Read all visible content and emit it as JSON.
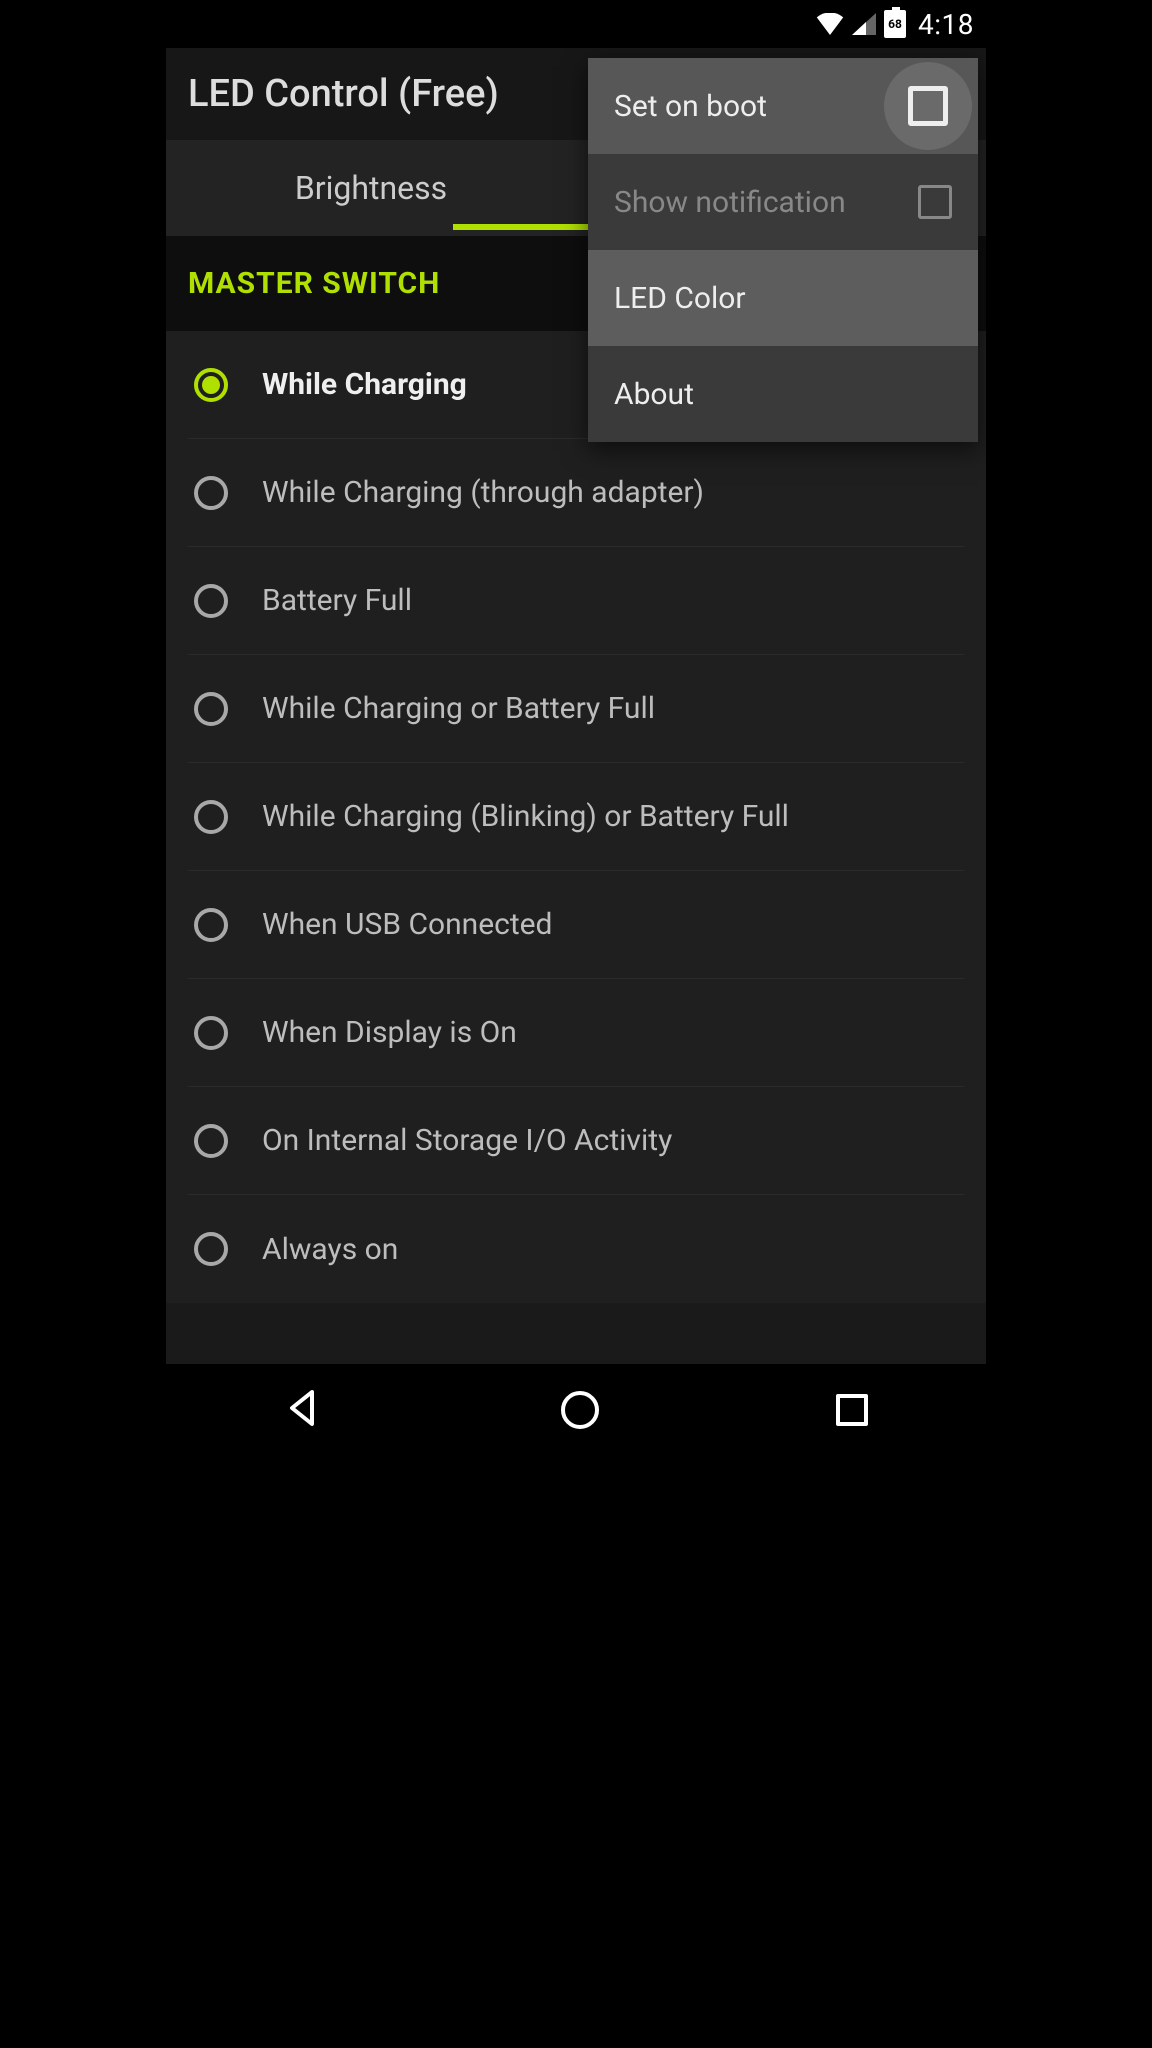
{
  "status": {
    "battery_pct": "68",
    "time": "4:18"
  },
  "app": {
    "title": "LED Control (Free)"
  },
  "tabs": {
    "t0": "Brightness"
  },
  "section": {
    "header": "MASTER SWITCH"
  },
  "options": [
    {
      "label": "While Charging",
      "selected": true
    },
    {
      "label": "While Charging (through adapter)",
      "selected": false
    },
    {
      "label": "Battery Full",
      "selected": false
    },
    {
      "label": "While Charging or Battery Full",
      "selected": false
    },
    {
      "label": "While Charging (Blinking) or Battery Full",
      "selected": false
    },
    {
      "label": "When USB Connected",
      "selected": false
    },
    {
      "label": "When Display is On",
      "selected": false
    },
    {
      "label": "On Internal Storage I/O Activity",
      "selected": false
    },
    {
      "label": "Always on",
      "selected": false
    }
  ],
  "menu": [
    {
      "label": "Set on boot",
      "checkbox": true,
      "highlighted": true,
      "ripple": true
    },
    {
      "label": "Show notification",
      "checkbox": true,
      "disabled": true
    },
    {
      "label": "LED Color",
      "highlighted": true
    },
    {
      "label": "About"
    }
  ]
}
